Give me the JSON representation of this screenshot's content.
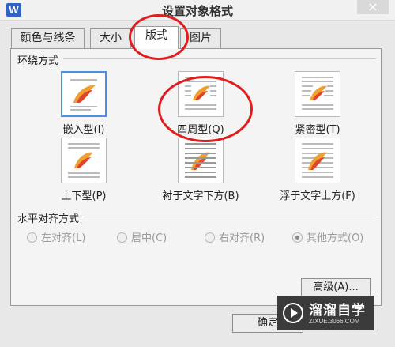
{
  "window": {
    "app_icon_text": "W",
    "title": "设置对象格式",
    "close_symbol": "×"
  },
  "tabs": [
    {
      "label": "颜色与线条",
      "active": false
    },
    {
      "label": "大小",
      "active": false
    },
    {
      "label": "版式",
      "active": true
    },
    {
      "label": "图片",
      "active": false
    }
  ],
  "wrap_section": {
    "label": "环绕方式",
    "options": [
      {
        "label": "嵌入型(I)",
        "selected": true
      },
      {
        "label": "四周型(Q)",
        "selected": false
      },
      {
        "label": "紧密型(T)",
        "selected": false
      },
      {
        "label": "上下型(P)",
        "selected": false
      },
      {
        "label": "衬于文字下方(B)",
        "selected": false
      },
      {
        "label": "浮于文字上方(F)",
        "selected": false
      }
    ]
  },
  "align_section": {
    "label": "水平对齐方式",
    "options": [
      {
        "label": "左对齐(L)",
        "checked": false
      },
      {
        "label": "居中(C)",
        "checked": false
      },
      {
        "label": "右对齐(R)",
        "checked": false
      },
      {
        "label": "其他方式(O)",
        "checked": true
      }
    ]
  },
  "buttons": {
    "advanced": "高级(A)...",
    "ok": "确定"
  },
  "watermark": {
    "name": "溜溜自学",
    "url": "ZIXUE.3066.COM"
  },
  "colors": {
    "selection_border": "#4a90e2",
    "annotation_red": "#e11d1d",
    "flame_orange": "#f0a030",
    "flame_red": "#e0442a"
  }
}
